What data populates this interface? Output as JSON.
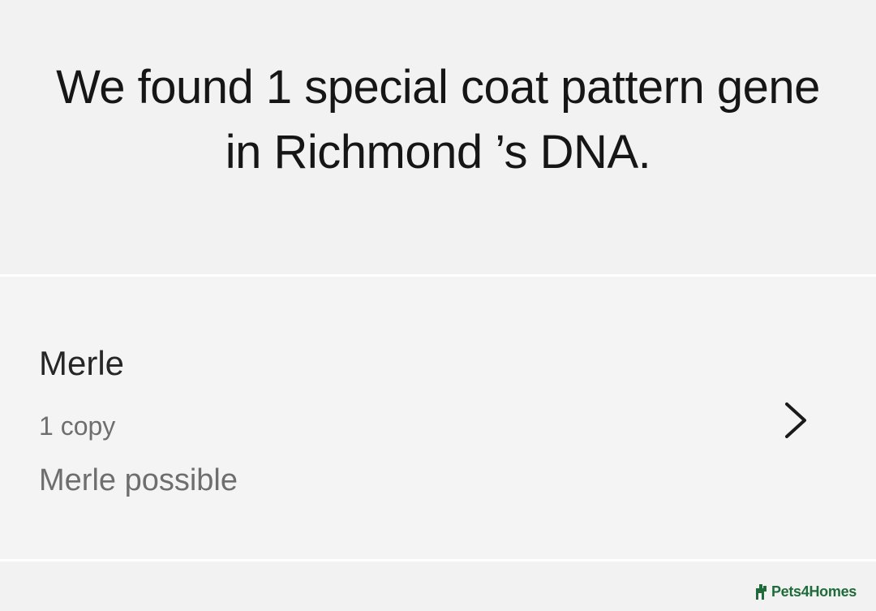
{
  "header": {
    "headline": "We found 1 special coat pattern gene in Richmond ’s DNA."
  },
  "gene": {
    "name": "Merle",
    "copies": "1 copy",
    "result": "Merle possible",
    "chevron_icon": "chevron-right-icon"
  },
  "watermark": {
    "brand": "Pets4Homes",
    "logo_icon": "pets4homes-logo-icon",
    "color": "#1f6b3a"
  }
}
